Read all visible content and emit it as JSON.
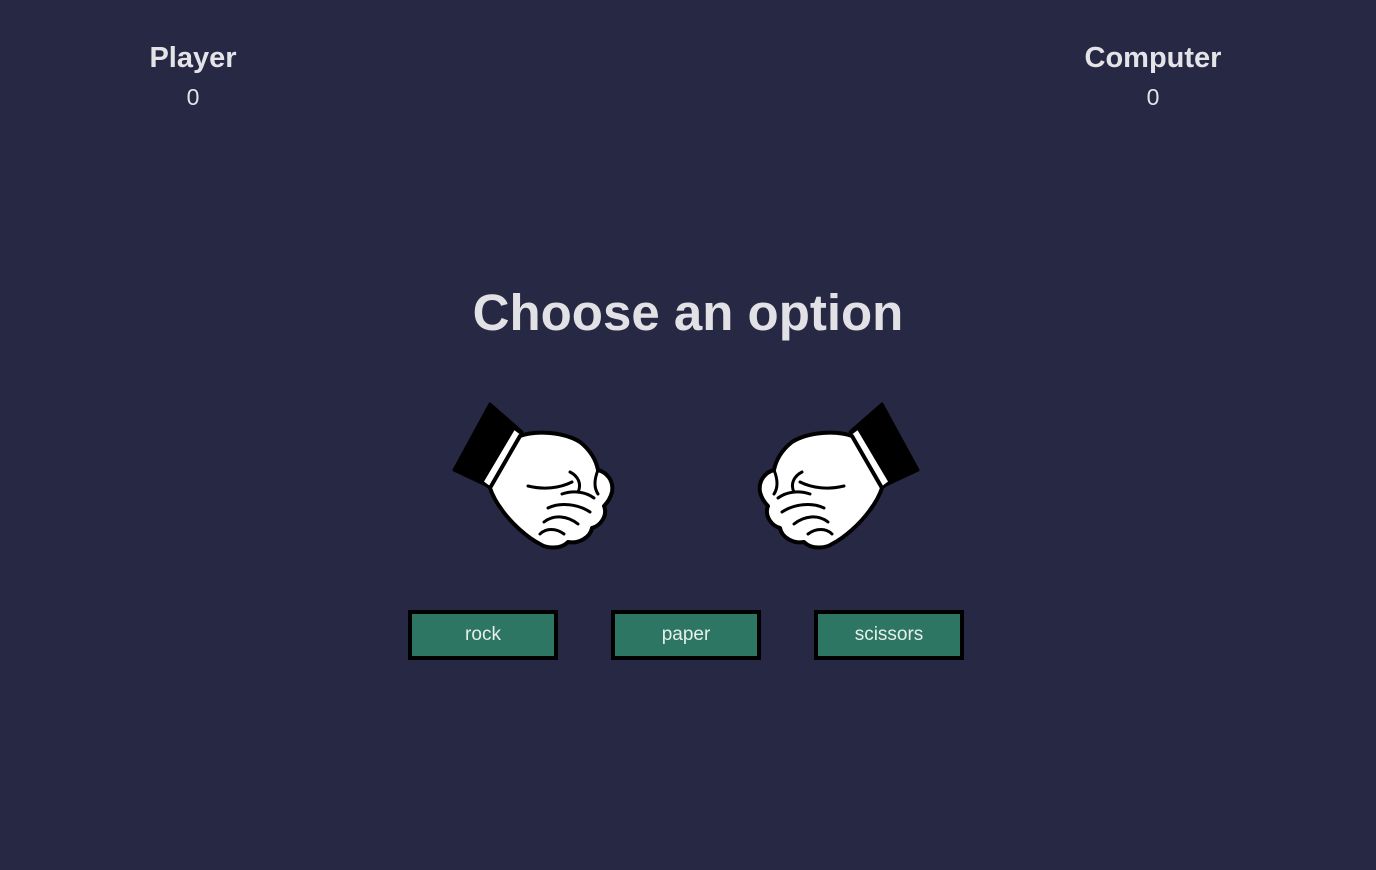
{
  "scoreboard": {
    "player": {
      "title": "Player",
      "score": "0"
    },
    "computer": {
      "title": "Computer",
      "score": "0"
    }
  },
  "prompt": "Choose an option",
  "hands": {
    "player": {
      "icon": "fist-icon",
      "gesture": "rock"
    },
    "computer": {
      "icon": "fist-icon",
      "gesture": "rock"
    }
  },
  "choices": [
    {
      "label": "rock"
    },
    {
      "label": "paper"
    },
    {
      "label": "scissors"
    }
  ],
  "colors": {
    "background": "#272844",
    "button": "#2c7663",
    "button_border": "#000000",
    "text": "#e4e4e8"
  }
}
